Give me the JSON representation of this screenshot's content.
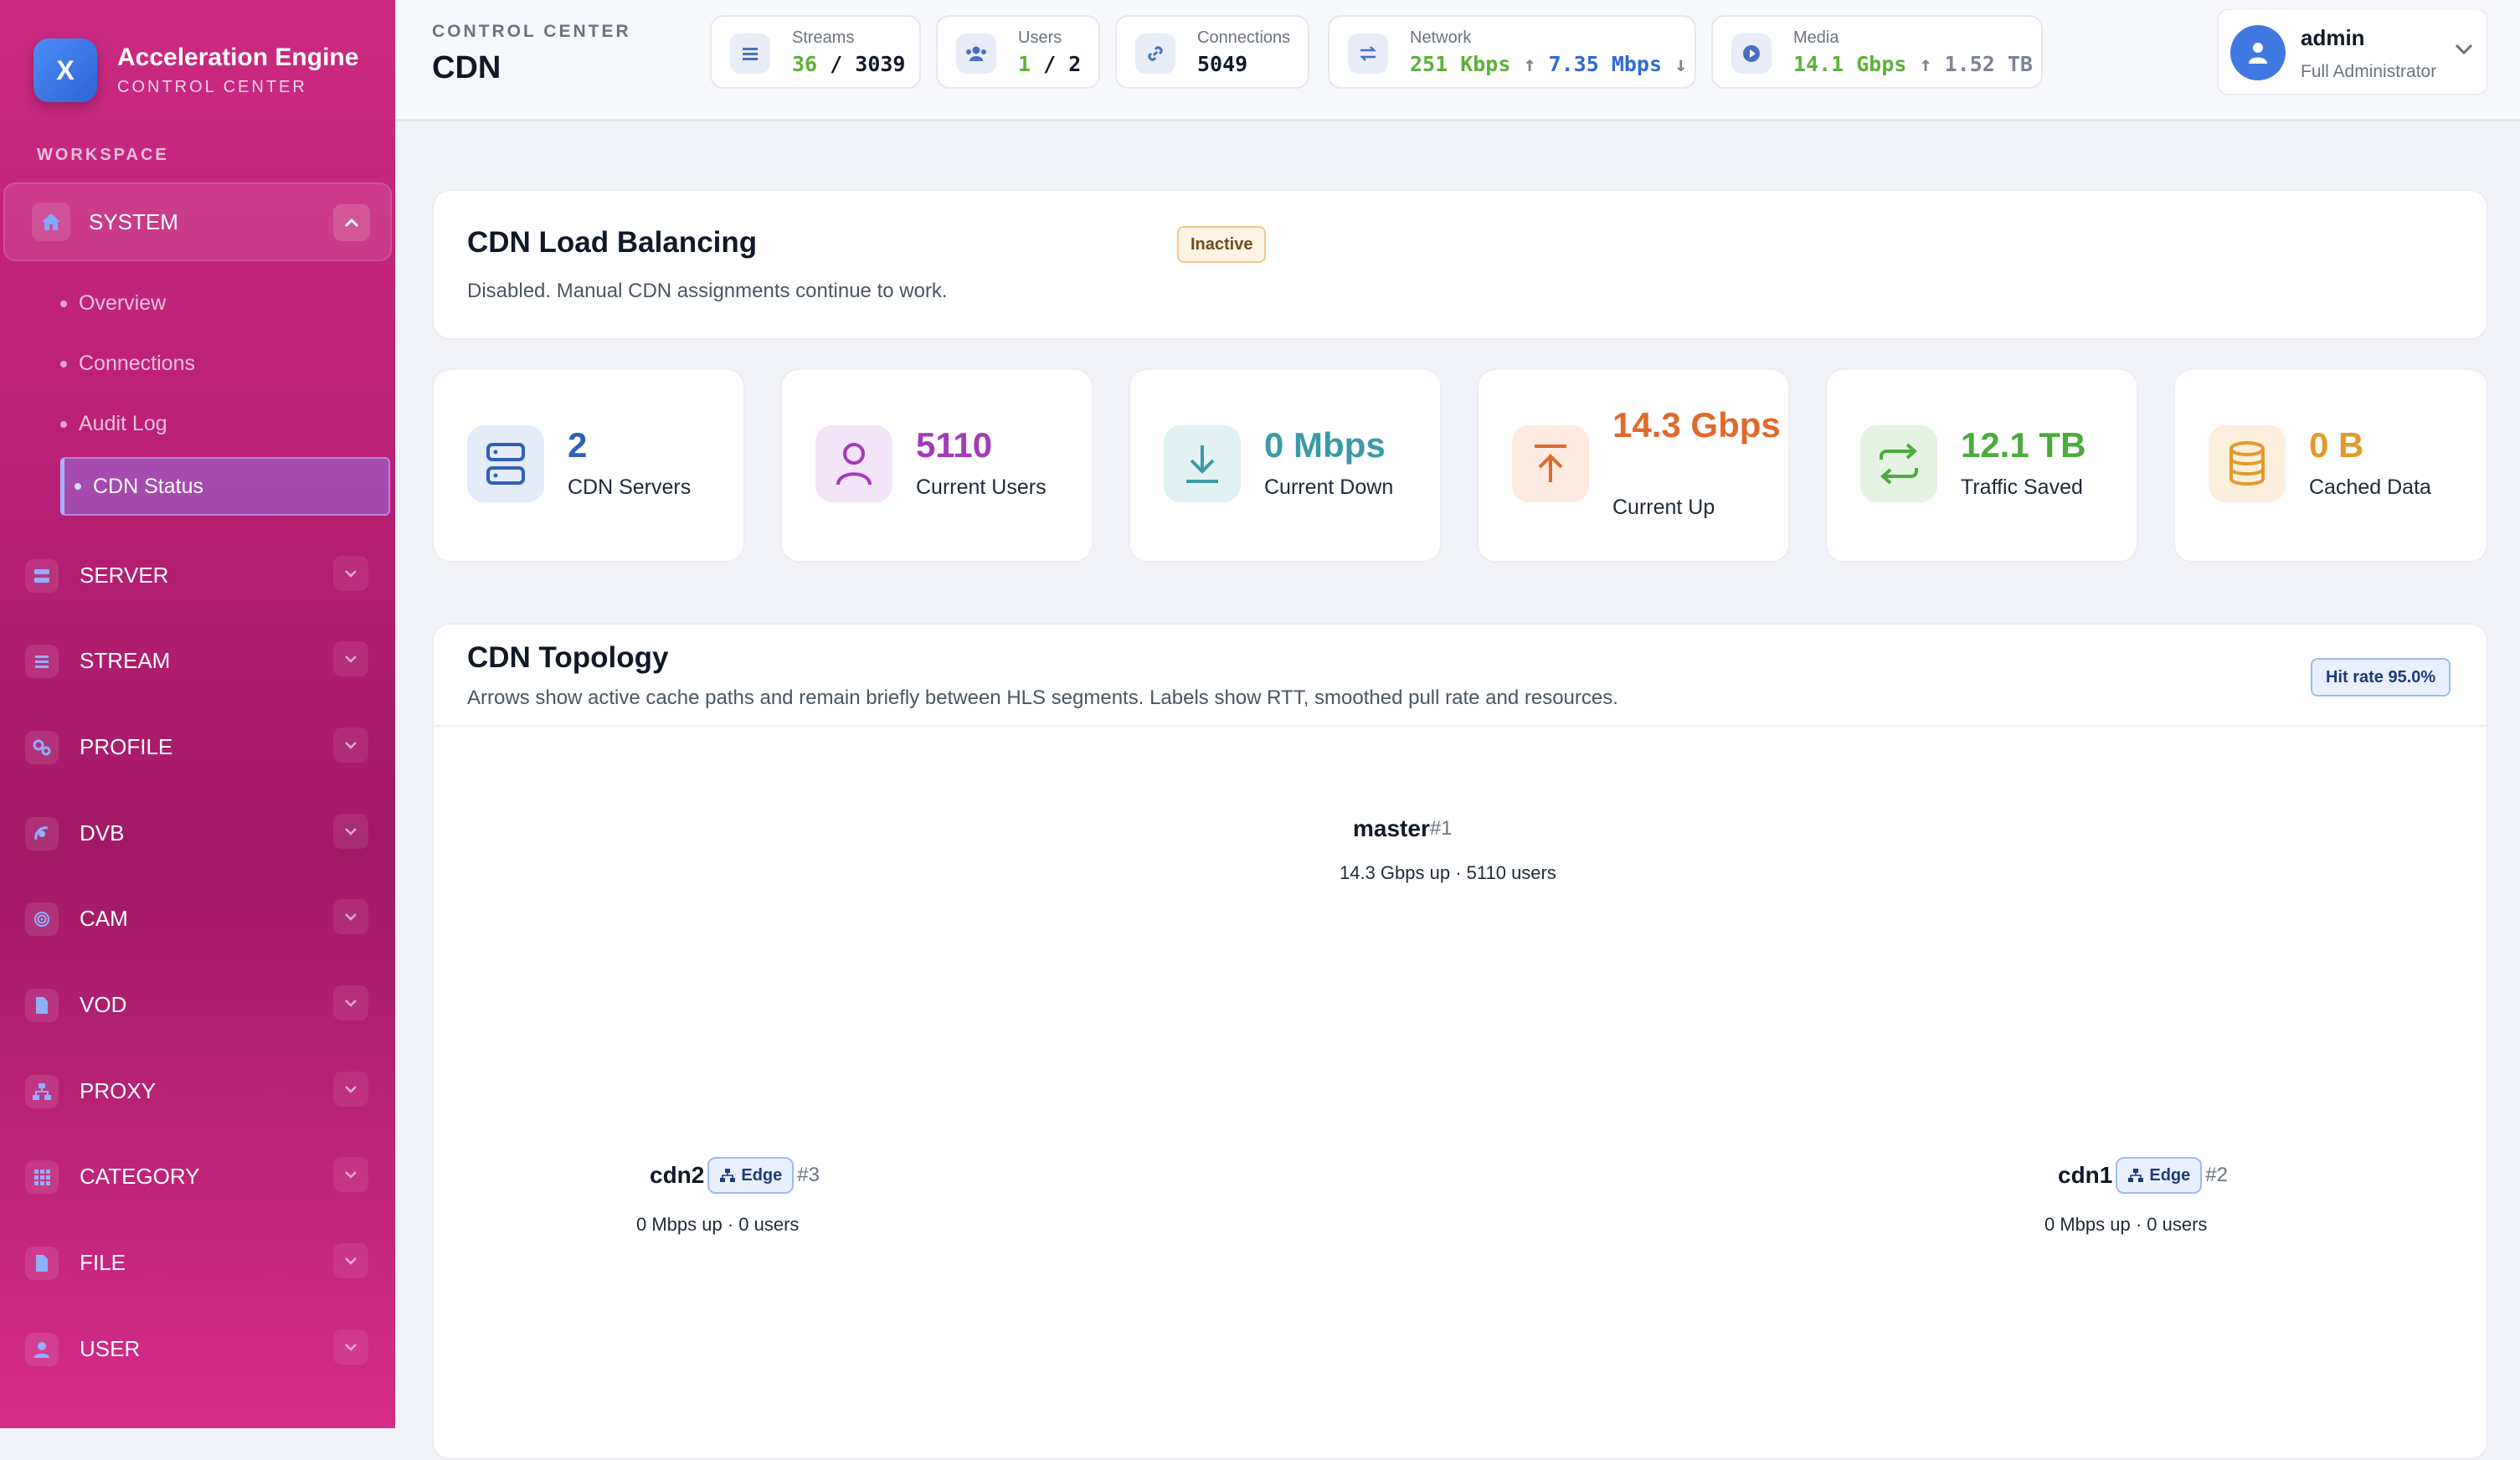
{
  "sidebar": {
    "brand_logo_letter": "X",
    "brand_title": "Acceleration Engine",
    "brand_subtitle": "CONTROL CENTER",
    "workspace_label": "WORKSPACE",
    "system_label": "SYSTEM",
    "sub_items": [
      "Overview",
      "Connections",
      "Audit Log",
      "CDN Status"
    ],
    "nav_items": [
      {
        "label": "SERVER",
        "icon": "server-icon"
      },
      {
        "label": "STREAM",
        "icon": "list-icon"
      },
      {
        "label": "PROFILE",
        "icon": "cogs-icon"
      },
      {
        "label": "DVB",
        "icon": "satellite-icon"
      },
      {
        "label": "CAM",
        "icon": "fingerprint-icon"
      },
      {
        "label": "VOD",
        "icon": "file-icon"
      },
      {
        "label": "PROXY",
        "icon": "network-icon"
      },
      {
        "label": "CATEGORY",
        "icon": "grid-icon"
      },
      {
        "label": "FILE",
        "icon": "file-icon"
      },
      {
        "label": "USER",
        "icon": "user-icon"
      }
    ]
  },
  "header": {
    "section_label": "CONTROL CENTER",
    "title": "CDN",
    "streams": {
      "label": "Streams",
      "active": "36",
      "sep": " / ",
      "total": "3039"
    },
    "users": {
      "label": "Users",
      "active": "1",
      "sep": " / ",
      "total": "2"
    },
    "connections": {
      "label": "Connections",
      "value": "5049"
    },
    "network": {
      "label": "Network",
      "up": "251 Kbps",
      "up_arrow": " ↑ ",
      "down": "7.35 Mbps",
      "down_arrow": " ↓"
    },
    "media": {
      "label": "Media",
      "up": "14.1 Gbps",
      "up_arrow": " ↑ ",
      "stored": "1.52 TB"
    },
    "user": {
      "name": "admin",
      "role": "Full Administrator"
    }
  },
  "load_balancing": {
    "title": "CDN Load Balancing",
    "badge": "Inactive",
    "description": "Disabled. Manual CDN assignments continue to work."
  },
  "stats": [
    {
      "value": "2",
      "label": "CDN Servers",
      "color": "#2f5fb8",
      "bg": "#e4ecfa",
      "icon": "server-icon"
    },
    {
      "value": "5110",
      "label": "Current Users",
      "color": "#a13bb8",
      "bg": "#f4e4f7",
      "icon": "user-icon"
    },
    {
      "value": "0 Mbps",
      "label": "Current Down",
      "color": "#3a9aa6",
      "bg": "#e2f2f3",
      "icon": "download-icon"
    },
    {
      "value": "14.3 Gbps",
      "label": "Current Up",
      "color": "#e0692c",
      "bg": "#fdebe1",
      "icon": "upload-icon"
    },
    {
      "value": "12.1 TB",
      "label": "Traffic Saved",
      "color": "#4caa3e",
      "bg": "#e5f4e2",
      "icon": "exchange-icon"
    },
    {
      "value": "0 B",
      "label": "Cached Data",
      "color": "#e39a2a",
      "bg": "#fcf0dd",
      "icon": "database-icon"
    }
  ],
  "topology": {
    "title": "CDN Topology",
    "description": "Arrows show active cache paths and remain briefly between HLS segments. Labels show RTT, smoothed pull rate and resources.",
    "hit_rate": "Hit rate 95.0%",
    "edge_label": "Edge",
    "nodes": {
      "master": {
        "name": "master",
        "num": "#1",
        "meta": "14.3 Gbps up · 5110 users"
      },
      "cdn2": {
        "name": "cdn2",
        "num": "#3",
        "meta": "0 Mbps up · 0 users"
      },
      "cdn1": {
        "name": "cdn1",
        "num": "#2",
        "meta": "0 Mbps up · 0 users"
      }
    }
  }
}
